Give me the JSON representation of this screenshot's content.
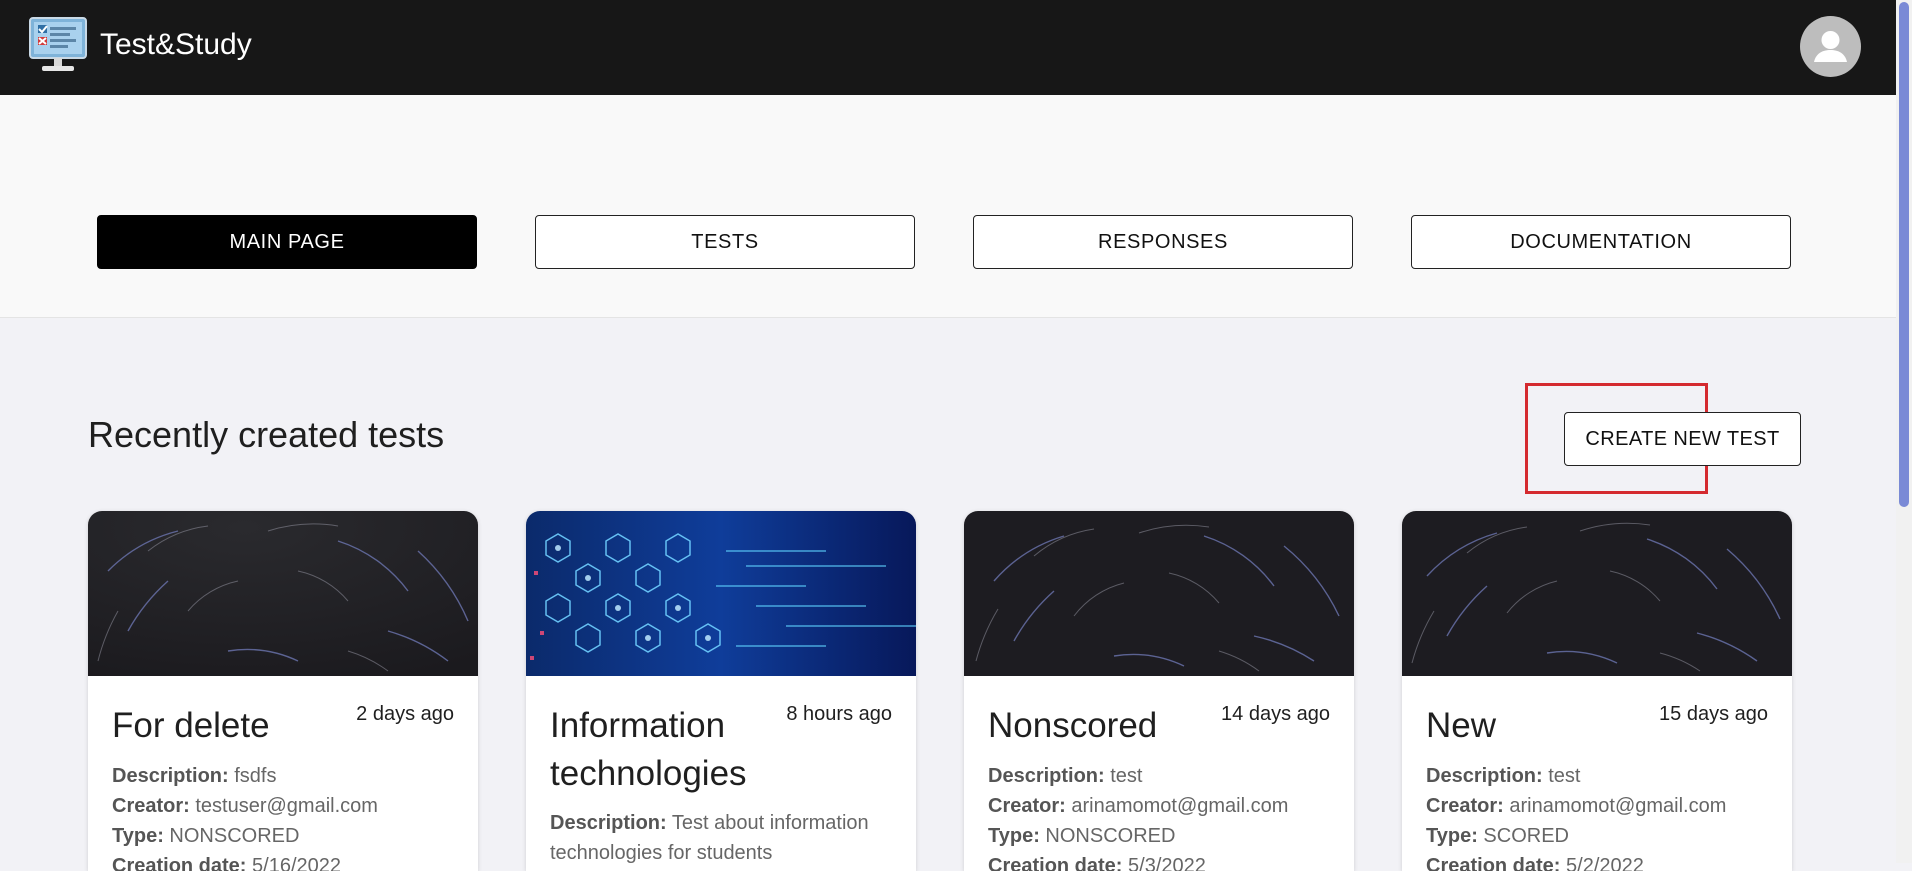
{
  "app": {
    "title": "Test&Study"
  },
  "nav": {
    "main_page": "MAIN PAGE",
    "tests": "TESTS",
    "responses": "RESPONSES",
    "documentation": "DOCUMENTATION"
  },
  "section": {
    "title": "Recently created tests",
    "create_button": "CREATE NEW TEST"
  },
  "labels": {
    "description": "Description:",
    "creator": "Creator:",
    "type": "Type:",
    "creation_date": "Creation date:"
  },
  "cards": [
    {
      "title": "For delete",
      "time": "2 days ago",
      "description": "fsdfs",
      "creator": "testuser@gmail.com",
      "type": "NONSCORED",
      "creation_date": "5/16/2022",
      "image": "star-trails"
    },
    {
      "title": "Information technologies",
      "time": "8 hours ago",
      "description": "Test about information technologies for students",
      "image": "tech-network"
    },
    {
      "title": "Nonscored",
      "time": "14 days ago",
      "description": "test",
      "creator": "arinamomot@gmail.com",
      "type": "NONSCORED",
      "creation_date": "5/3/2022",
      "image": "star-trails"
    },
    {
      "title": "New",
      "time": "15 days ago",
      "description": "test",
      "creator": "arinamomot@gmail.com",
      "type": "SCORED",
      "creation_date": "5/2/2022",
      "image": "star-trails"
    }
  ],
  "colors": {
    "appbar": "#171717",
    "highlight": "#d42a2f",
    "scroll_thumb": "#7a8ad6"
  }
}
